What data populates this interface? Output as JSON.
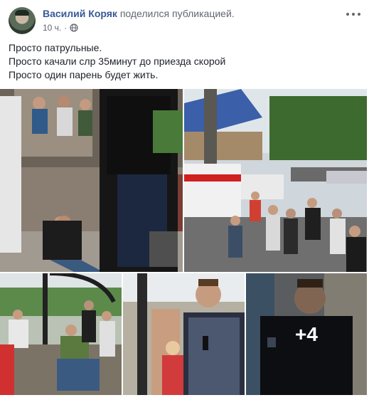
{
  "post": {
    "author": "Василий Коряк",
    "action": "поделился публикацией.",
    "time": "10 ч.",
    "meta_separator": "·",
    "privacy_icon": "globe-icon",
    "menu_icon": "more-options-icon",
    "text_lines": [
      "Просто патрульные.",
      "Просто качали слр 35минут до приезда скорой",
      "Просто один парень будет жить."
    ]
  },
  "gallery": {
    "photos": [
      {
        "description_icon": "photo-rescue-scene"
      },
      {
        "description_icon": "photo-street-ambulance"
      },
      {
        "description_icon": "photo-crowd-bus-stop"
      },
      {
        "description_icon": "photo-patrol-officer"
      },
      {
        "description_icon": "photo-officer-closeup"
      }
    ],
    "more_label": "+4"
  },
  "colors": {
    "link": "#385898",
    "secondary_text": "#606770",
    "body_text": "#1d2129"
  }
}
